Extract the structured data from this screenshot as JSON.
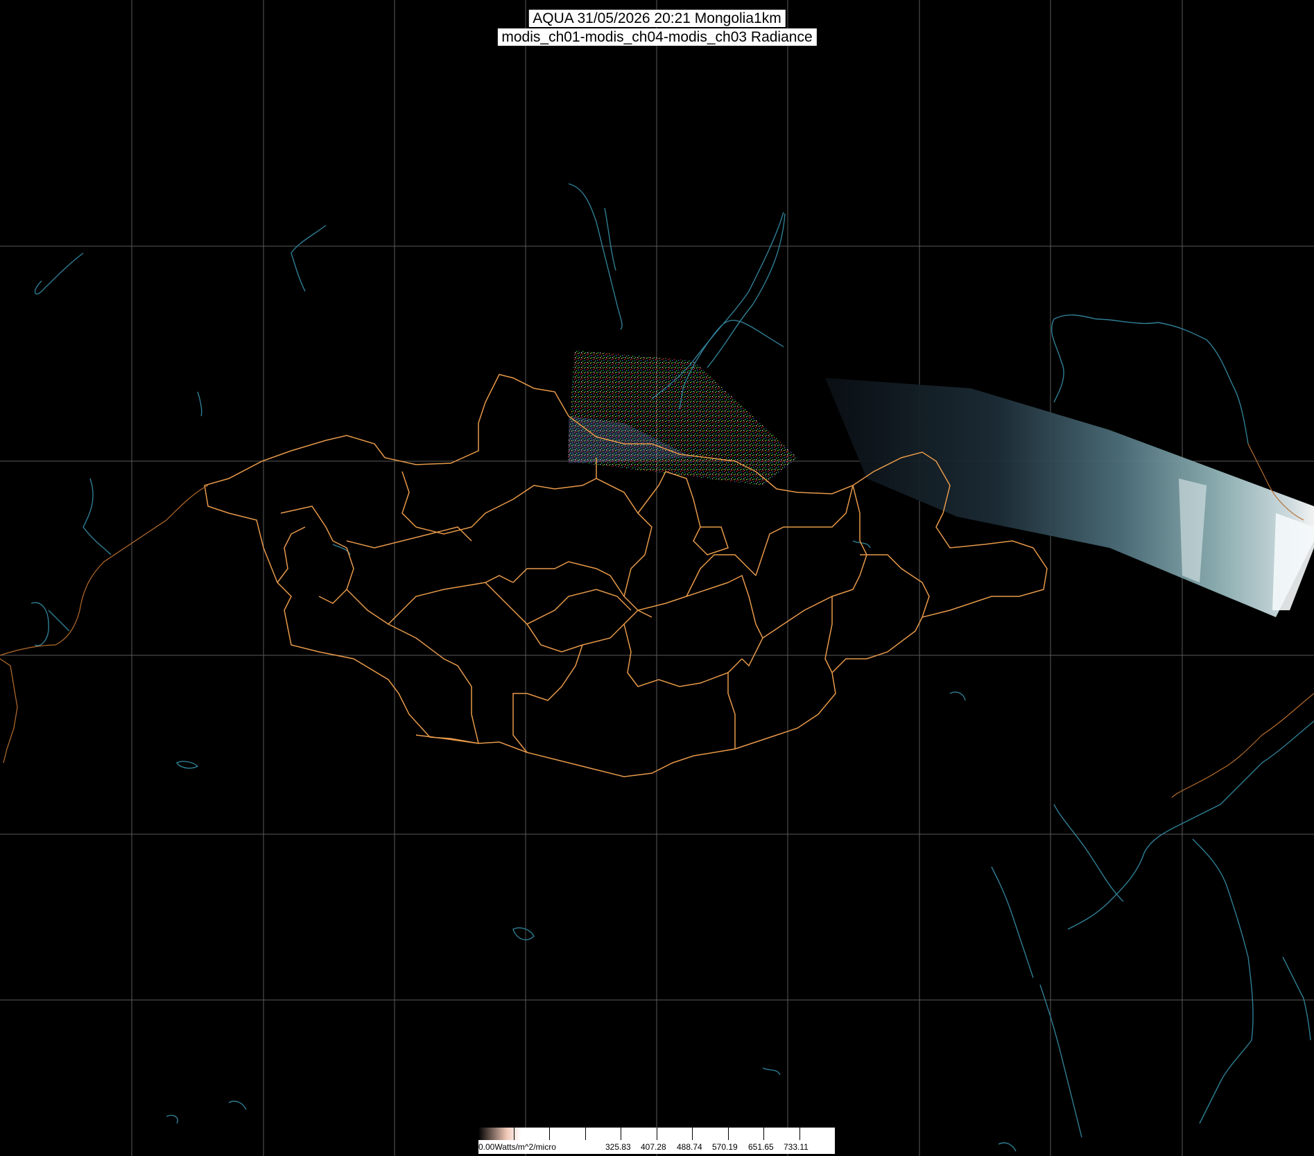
{
  "title": {
    "line1": "AQUA 31/05/2026 20:21 Mongolia1km",
    "line2": "modis_ch01-modis_ch04-modis_ch03 Radiance"
  },
  "colors": {
    "background": "#000000",
    "graticule": "#5a5a5a",
    "admin_borders": "#e89a4a",
    "coastlines": "#2f7f95",
    "swath_noise": [
      "#ff3b3b",
      "#33ff55",
      "#4a7bff",
      "#ffffff",
      "#ffee33"
    ],
    "swath_imagery": "#7fb0b8"
  },
  "colorbar": {
    "unit_label": "0.00Watts/m^2/micro",
    "tick_labels": [
      "325.83",
      "407.28",
      "488.74",
      "570.19",
      "651.65",
      "733.11"
    ]
  }
}
